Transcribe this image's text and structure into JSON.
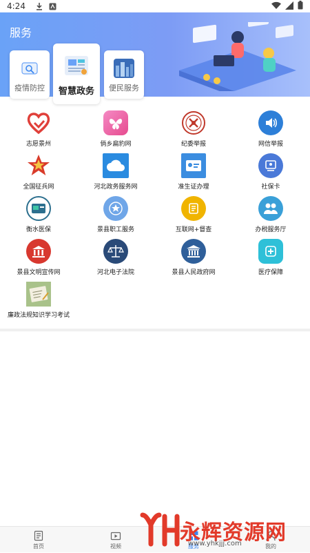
{
  "statusbar": {
    "time": "4:24"
  },
  "header": {
    "title": "服务"
  },
  "tabs": [
    {
      "label": "疫情防控"
    },
    {
      "label": "智慧政务"
    },
    {
      "label": "便民服务"
    }
  ],
  "services": [
    {
      "label": "志愿景州",
      "icon": "heart-hand-icon",
      "color": "#e0403a"
    },
    {
      "label": "倘乡扁豹网",
      "icon": "butterfly-icon",
      "color": "#f06aa8"
    },
    {
      "label": "纪委举报",
      "icon": "emblem-icon",
      "color": "#c0392b"
    },
    {
      "label": "网信举报",
      "icon": "speaker-icon",
      "color": "#2d7fd8"
    },
    {
      "label": "全国征兵网",
      "icon": "army-star-icon",
      "color": "#d93b2a"
    },
    {
      "label": "河北政务服务网",
      "icon": "cloud-icon",
      "color": "#2a8be0"
    },
    {
      "label": "准生证办理",
      "icon": "id-card-icon",
      "color": "#3b8de0"
    },
    {
      "label": "社保卡",
      "icon": "card-icon",
      "color": "#4a79d8"
    },
    {
      "label": "衡水医保",
      "icon": "medical-card-icon",
      "color": "#2c6f8e"
    },
    {
      "label": "景县职工服务",
      "icon": "star-badge-icon",
      "color": "#6fa6e8"
    },
    {
      "label": "互联网+督查",
      "icon": "coin-icon",
      "color": "#f0b400"
    },
    {
      "label": "办税服务厅",
      "icon": "people-icon",
      "color": "#3aa0d8"
    },
    {
      "label": "景县文明宣传网",
      "icon": "building-icon",
      "color": "#d8382f"
    },
    {
      "label": "河北电子法院",
      "icon": "scale-icon",
      "color": "#2a4a78"
    },
    {
      "label": "景县人民政府网",
      "icon": "government-icon",
      "color": "#2f5f9a"
    },
    {
      "label": "医疗保障",
      "icon": "medical-icon",
      "color": "#2ec0d8"
    },
    {
      "label": "廉政法规知识学习考试",
      "icon": "exam-photo-icon",
      "color": "#9fbf7a"
    }
  ],
  "bottom_nav": [
    {
      "label": "首页",
      "icon": "document-icon"
    },
    {
      "label": "视频",
      "icon": "video-icon"
    },
    {
      "label": "服务",
      "icon": "service-icon"
    },
    {
      "label": "我的",
      "icon": "user-icon"
    }
  ],
  "watermark": {
    "text": "永辉资源网",
    "url": "www.yhkjjj.com"
  }
}
